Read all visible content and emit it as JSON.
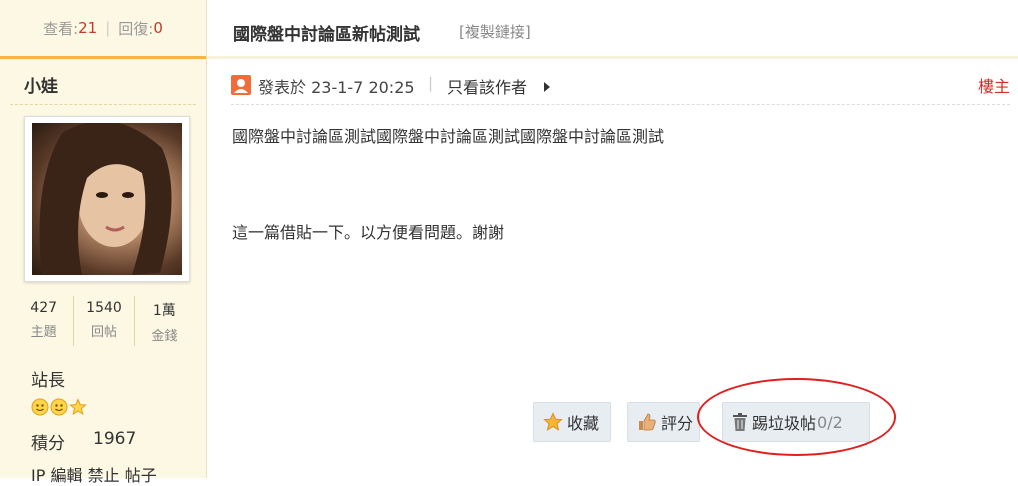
{
  "sidebar": {
    "views_label": "查看:",
    "views": "21",
    "replies_label": "回復:",
    "replies": "0",
    "username": "小娃",
    "counts": [
      {
        "value": "427",
        "label": "主題"
      },
      {
        "value": "1540",
        "label": "回帖"
      },
      {
        "value": "1萬",
        "label": "金錢"
      }
    ],
    "rank": "站長",
    "score_label": "積分",
    "score": "1967",
    "links": [
      "IP",
      "編輯",
      "禁止",
      "帖子"
    ]
  },
  "thread": {
    "title": "國際盤中討論區新帖測試",
    "copy_link": "[複製鏈接]"
  },
  "post": {
    "posted_on": "發表於 23-1-7 20:25",
    "separator": "|",
    "only_author": "只看該作者",
    "floor": "樓主",
    "line1": "國際盤中討論區測試國際盤中討論區測試國際盤中討論區測試",
    "line2": "這一篇借貼一下。以方便看問題。謝謝"
  },
  "actions": {
    "favorite": "收藏",
    "rate": "評分",
    "trash": "踢垃圾帖",
    "trash_count": "0/2"
  },
  "colors": {
    "accent_orange": "#f7b44a",
    "count_red": "#c0392b",
    "floor_red": "#d32f2f",
    "annotation_red": "#e02020"
  }
}
